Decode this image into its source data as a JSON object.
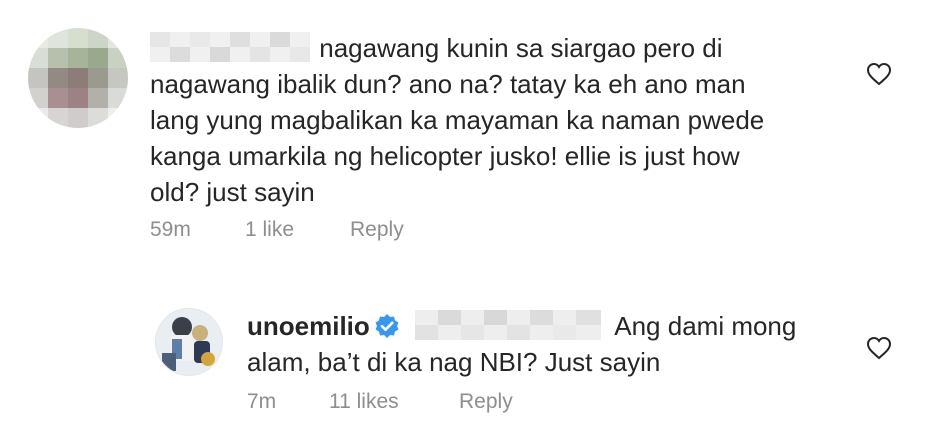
{
  "comments": [
    {
      "text": "nagawang kunin sa siargao pero di nagawang ibalik dun? ano na? tatay ka eh ano man lang yung magbalikan ka mayaman ka naman pwede kanga umarkila ng helicopter jusko! ellie is just how old? just sayin",
      "line1": "nagawang kunin sa siargao pero di",
      "line2": "nagawang ibalik dun? ano na? tatay ka eh ano man",
      "line3": "lang yung magbalikan ka mayaman ka naman pwede",
      "line4": "kanga umarkila ng helicopter jusko! ellie is just how",
      "line5": "old? just sayin",
      "time": "59m",
      "likes": "1 like",
      "reply": "Reply"
    },
    {
      "username": "unoemilio",
      "line1": "Ang dami mong",
      "line2": "alam, ba’t di ka nag NBI? Just sayin",
      "time": "7m",
      "likes": "11 likes",
      "reply": "Reply"
    }
  ],
  "icons": {
    "like": "heart-outline-icon",
    "verified": "verified-badge-icon"
  },
  "colors": {
    "text": "#262626",
    "meta": "#8e8e8e",
    "verified": "#3897f0"
  }
}
